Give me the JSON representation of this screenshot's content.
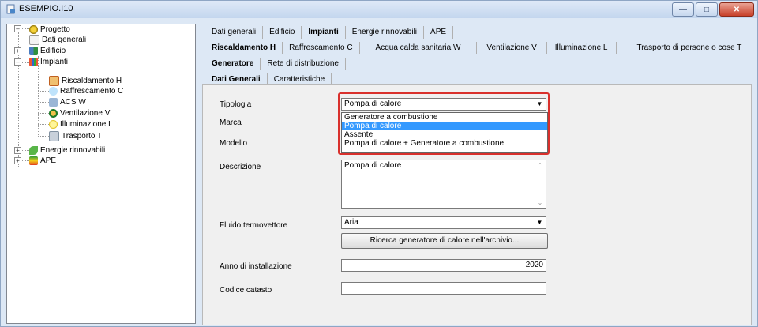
{
  "window": {
    "title": "ESEMPIO.I10"
  },
  "tree": {
    "items": [
      {
        "label": "Progetto"
      },
      {
        "label": "Dati generali"
      },
      {
        "label": "Edificio"
      },
      {
        "label": "Impianti"
      },
      {
        "label": "Riscaldamento H"
      },
      {
        "label": "Raffrescamento C"
      },
      {
        "label": "ACS W"
      },
      {
        "label": "Ventilazione V"
      },
      {
        "label": "Illuminazione L"
      },
      {
        "label": "Trasporto T"
      },
      {
        "label": "Energie rinnovabili"
      },
      {
        "label": "APE"
      }
    ]
  },
  "tabs_top": [
    "Dati generali",
    "Edificio",
    "Impianti",
    "Energie rinnovabili",
    "APE"
  ],
  "tabs_impianti": [
    "Riscaldamento H",
    "Raffrescamento C",
    "Acqua calda sanitaria W",
    "Ventilazione V",
    "Illuminazione L",
    "Trasporto di persone o cose T"
  ],
  "tabs_sub": [
    "Generatore",
    "Rete di distribuzione"
  ],
  "tabs_inner": [
    "Dati Generali",
    "Caratteristiche"
  ],
  "form": {
    "tipologia_label": "Tipologia",
    "tipologia_value": "Pompa di calore",
    "tipologia_options": [
      "Generatore a combustione",
      "Pompa di calore",
      "Assente",
      "Pompa di calore + Generatore a combustione"
    ],
    "marca_label": "Marca",
    "modello_label": "Modello",
    "descrizione_label": "Descrizione",
    "descrizione_value": "Pompa di calore",
    "fluido_label": "Fluido termovettore",
    "fluido_value": "Aria",
    "ricerca_button": "Ricerca generatore di calore nell'archivio...",
    "anno_label": "Anno di installazione",
    "anno_value": "2020",
    "codice_label": "Codice catasto",
    "codice_value": ""
  },
  "colors": {
    "selection": "#3399ff",
    "highlight": "#d9302c"
  }
}
